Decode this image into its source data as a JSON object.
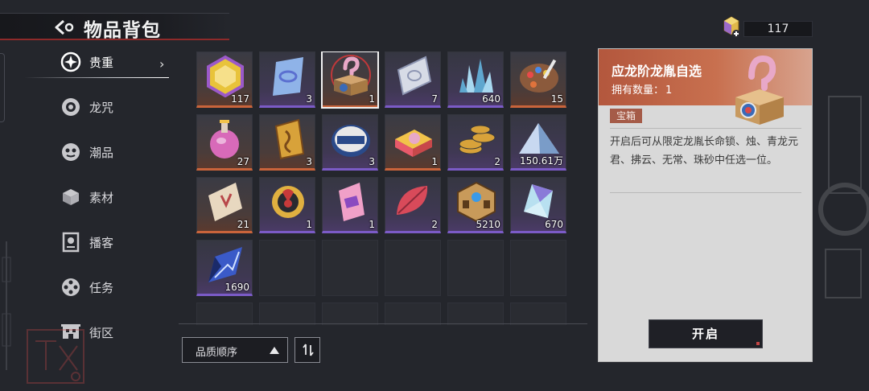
{
  "header": {
    "title": "物品背包"
  },
  "currency": {
    "amount": "117",
    "icon": "gem-plus-icon"
  },
  "sidebar": {
    "items": [
      {
        "label": "贵重",
        "icon": "sparkle-badge-icon",
        "active": true
      },
      {
        "label": "龙咒",
        "icon": "swirl-disc-icon"
      },
      {
        "label": "潮品",
        "icon": "mask-face-icon"
      },
      {
        "label": "素材",
        "icon": "box-stack-icon"
      },
      {
        "label": "播客",
        "icon": "podcast-device-icon"
      },
      {
        "label": "任务",
        "icon": "film-reel-icon"
      },
      {
        "label": "街区",
        "icon": "city-building-icon"
      }
    ]
  },
  "inventory": {
    "items": [
      {
        "name": "gold-gem",
        "count": "117",
        "quality": "orange",
        "colors": [
          "#e8c33a",
          "#9b59c9"
        ]
      },
      {
        "name": "blue-crystal-chip",
        "count": "3",
        "quality": "purple",
        "colors": [
          "#8fb3e8",
          "#5b6fd0"
        ]
      },
      {
        "name": "mystery-box",
        "count": "1",
        "quality": "orange",
        "colors": [
          "#d2a56f",
          "#8e6a44"
        ],
        "selected": true
      },
      {
        "name": "silver-ticket",
        "count": "7",
        "quality": "purple",
        "colors": [
          "#d7dbe6",
          "#8e96b3"
        ]
      },
      {
        "name": "ice-crystal",
        "count": "640",
        "quality": "purple",
        "colors": [
          "#a8d8f0",
          "#5fa7cf"
        ]
      },
      {
        "name": "paint-palette",
        "count": "15",
        "quality": "orange",
        "colors": [
          "#8b5a3c",
          "#e0733c"
        ]
      },
      {
        "name": "potion-flask",
        "count": "27",
        "quality": "orange",
        "colors": [
          "#d86ab9",
          "#f2c34a"
        ]
      },
      {
        "name": "golden-talisman",
        "count": "3",
        "quality": "orange",
        "colors": [
          "#d8a23a",
          "#7a4a1a"
        ]
      },
      {
        "name": "dragon-tin",
        "count": "3",
        "quality": "purple",
        "colors": [
          "#e8e8e8",
          "#2a4a8a"
        ]
      },
      {
        "name": "candy-box",
        "count": "1",
        "quality": "orange",
        "colors": [
          "#e85a6a",
          "#f2c34a"
        ]
      },
      {
        "name": "coin-stack",
        "count": "2",
        "quality": "purple",
        "colors": [
          "#d8a23a",
          "#3a3a3a"
        ]
      },
      {
        "name": "shard-pile",
        "count": "150.61万",
        "quality": "purple",
        "colors": [
          "#c8d8f0",
          "#7a9cc8"
        ]
      },
      {
        "name": "parchment-ticket",
        "count": "21",
        "quality": "orange",
        "colors": [
          "#e8d8c0",
          "#b8484a"
        ]
      },
      {
        "name": "gold-medal",
        "count": "1",
        "quality": "purple",
        "colors": [
          "#e0b040",
          "#c83a3a"
        ]
      },
      {
        "name": "pink-ticket",
        "count": "1",
        "quality": "purple",
        "colors": [
          "#f0a0c8",
          "#8a4ac0"
        ]
      },
      {
        "name": "red-leaf",
        "count": "2",
        "quality": "purple",
        "colors": [
          "#d84a5a",
          "#8a2a3a"
        ]
      },
      {
        "name": "bronze-cube",
        "count": "5210",
        "quality": "purple",
        "colors": [
          "#c89a5a",
          "#5a3a1a"
        ]
      },
      {
        "name": "prism-crystal",
        "count": "670",
        "quality": "purple",
        "colors": [
          "#b8e0f0",
          "#8a7ad8"
        ]
      },
      {
        "name": "dark-blue-shard",
        "count": "1690",
        "quality": "purple",
        "colors": [
          "#3a5ac8",
          "#1a2a6a"
        ]
      }
    ]
  },
  "sort": {
    "label": "品质顺序",
    "toggle_icon": "sort-order-icon"
  },
  "detail": {
    "name": "应龙阶龙胤自选",
    "owned_label": "拥有数量：",
    "owned_count": "1",
    "tag": "宝箱",
    "description": "开启后可从限定龙胤长命锁、烛、青龙元君、拂云、无常、珠砂中任选一位。",
    "action_label": "开启"
  }
}
